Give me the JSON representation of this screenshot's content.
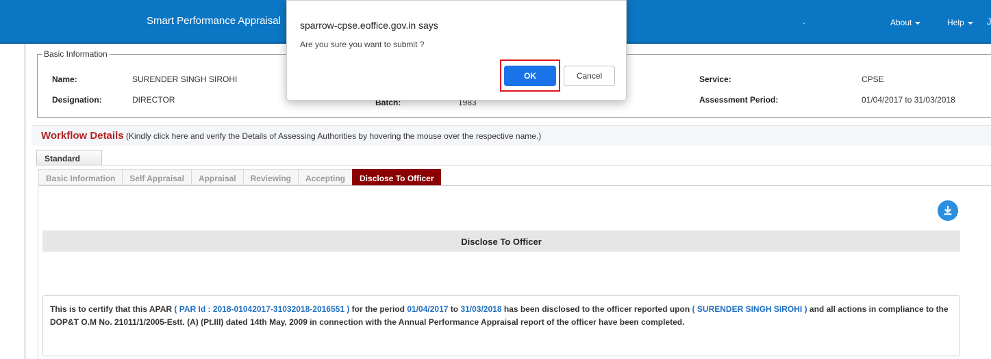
{
  "header": {
    "app_title": "Smart Performance Appraisal",
    "dot": ".",
    "about_label": "About",
    "help_label": "Help",
    "more_glyph": "J"
  },
  "basic_info": {
    "legend": "Basic Information",
    "name_label": "Name:",
    "name_value": "SURENDER SINGH SIROHI",
    "designation_label": "Designation:",
    "designation_value": "DIRECTOR",
    "batch_label": "Batch:",
    "batch_value": "1983",
    "service_label": "Service:",
    "service_value": "CPSE",
    "period_label": "Assessment Period:",
    "period_value": "01/04/2017 to 31/03/2018"
  },
  "workflow": {
    "title": "Workflow Details",
    "hint": "(Kindly click here and verify the Details of Assessing Authorities by hovering the mouse over the respective name.)"
  },
  "standard_tab": "Standard",
  "tabs": [
    {
      "label": "Basic Information",
      "active": false
    },
    {
      "label": "Self Appraisal",
      "active": false
    },
    {
      "label": "Appraisal",
      "active": false
    },
    {
      "label": "Reviewing",
      "active": false
    },
    {
      "label": "Accepting",
      "active": false
    },
    {
      "label": "Disclose To Officer",
      "active": true
    }
  ],
  "section_title": "Disclose To Officer",
  "certificate": {
    "p1": "This is to certify that this APAR",
    "par_id": "( PAR Id : 2018-01042017-31032018-2016551 )",
    "p2": "for the period",
    "from_date": "01/04/2017",
    "p3": "to",
    "to_date": "31/03/2018",
    "p4": "has been disclosed to the officer reported upon",
    "officer": "( SURENDER SINGH SIROHI )",
    "p5": "and all actions in compliance to the DOP&T O.M No. 21011/1/2005-Estt. (A) (Pt.III) dated 14th May, 2009 in connection with the Annual Performance Appraisal report of the officer have been completed."
  },
  "dialog": {
    "title": "sparrow-cpse.eoffice.gov.in says",
    "message": "Are you sure you want to submit ?",
    "ok_label": "OK",
    "cancel_label": "Cancel"
  },
  "colors": {
    "header_bg": "#0b76c4",
    "workflow_title": "#b22222",
    "active_tab": "#8b0000",
    "link_blue": "#1e6fc2",
    "ok_button": "#1a73e8",
    "highlight_frame": "#e0141e"
  },
  "icons": {
    "download": "download-icon"
  }
}
